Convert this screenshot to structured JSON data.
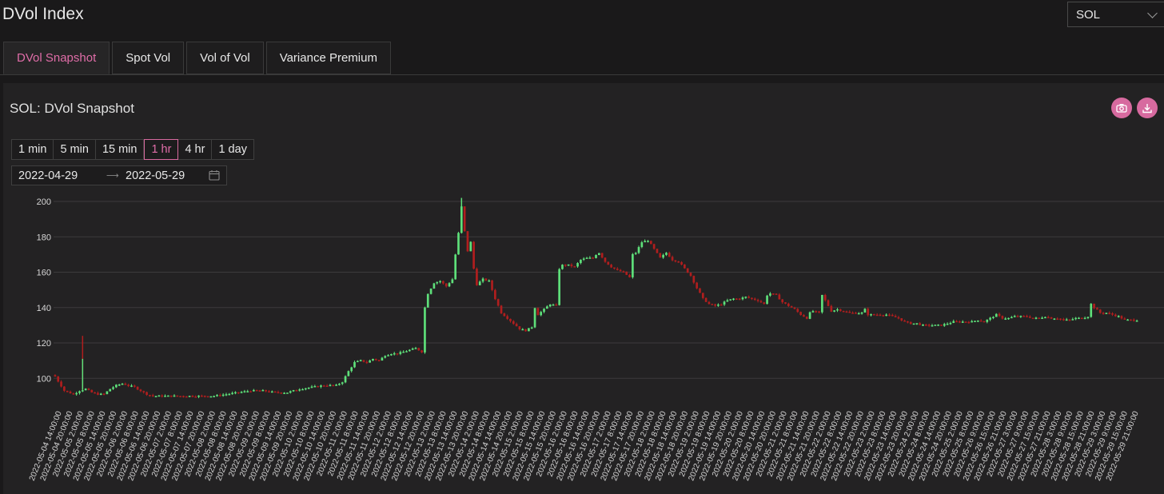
{
  "app": {
    "title": "DVol Index"
  },
  "asset_select": {
    "value": "SOL"
  },
  "tabs": [
    {
      "label": "DVol Snapshot",
      "active": true
    },
    {
      "label": "Spot Vol",
      "active": false
    },
    {
      "label": "Vol of Vol",
      "active": false
    },
    {
      "label": "Variance Premium",
      "active": false
    }
  ],
  "panel": {
    "title": "SOL: DVol Snapshot",
    "camera_icon": "camera-icon",
    "download_icon": "download-icon"
  },
  "ranges": [
    "1 min",
    "5 min",
    "15 min",
    "1 hr",
    "4 hr",
    "1 day"
  ],
  "selected_range": "1 hr",
  "date_range": {
    "start": "2022-04-29",
    "end": "2022-05-29",
    "icon": "calendar-icon"
  },
  "colors": {
    "accent": "#d76a9f",
    "up": "#5ee07a",
    "down": "#b01e1e",
    "background": "#1a191a"
  },
  "chart_data": {
    "type": "candlestick",
    "yticks": [
      100,
      120,
      140,
      160,
      180,
      200
    ],
    "ylim": [
      88,
      204
    ],
    "grid": true,
    "x_tick_labels": [
      "2022-05-04 14:00:00",
      "2022-05-04 20:00:00",
      "2022-05-05 2:00:00",
      "2022-05-05 8:00:00",
      "2022-05-05 14:00:00",
      "2022-05-05 20:00:00",
      "2022-05-06 2:00:00",
      "2022-05-06 8:00:00",
      "2022-05-06 14:00:00",
      "2022-05-06 20:00:00",
      "2022-05-07 2:00:00",
      "2022-05-07 8:00:00",
      "2022-05-07 14:00:00",
      "2022-05-07 20:00:00",
      "2022-05-08 2:00:00",
      "2022-05-08 8:00:00",
      "2022-05-08 14:00:00",
      "2022-05-08 20:00:00",
      "2022-05-09 2:00:00",
      "2022-05-09 8:00:00",
      "2022-05-09 14:00:00",
      "2022-05-09 20:00:00",
      "2022-05-10 2:00:00",
      "2022-05-10 8:00:00",
      "2022-05-10 14:00:00",
      "2022-05-10 20:00:00",
      "2022-05-11 2:00:00",
      "2022-05-11 8:00:00",
      "2022-05-11 14:00:00",
      "2022-05-11 20:00:00",
      "2022-05-12 2:00:00",
      "2022-05-12 8:00:00",
      "2022-05-12 14:00:00",
      "2022-05-12 20:00:00",
      "2022-05-13 2:00:00",
      "2022-05-13 8:00:00",
      "2022-05-13 14:00:00",
      "2022-05-13 20:00:00",
      "2022-05-14 2:00:00",
      "2022-05-14 8:00:00",
      "2022-05-14 14:00:00",
      "2022-05-14 20:00:00",
      "2022-05-15 2:00:00",
      "2022-05-15 8:00:00",
      "2022-05-15 14:00:00",
      "2022-05-15 20:00:00",
      "2022-05-16 2:00:00",
      "2022-05-16 8:00:00",
      "2022-05-16 14:00:00",
      "2022-05-16 20:00:00",
      "2022-05-17 2:00:00",
      "2022-05-17 8:00:00",
      "2022-05-17 14:00:00",
      "2022-05-17 20:00:00",
      "2022-05-18 2:00:00",
      "2022-05-18 8:00:00",
      "2022-05-18 14:00:00",
      "2022-05-18 20:00:00",
      "2022-05-19 2:00:00",
      "2022-05-19 8:00:00",
      "2022-05-19 14:00:00",
      "2022-05-19 20:00:00",
      "2022-05-20 2:00:00",
      "2022-05-20 8:00:00",
      "2022-05-20 14:00:00",
      "2022-05-20 20:00:00",
      "2022-05-21 2:00:00",
      "2022-05-21 8:00:00",
      "2022-05-21 14:00:00",
      "2022-05-21 20:00:00",
      "2022-05-22 2:00:00",
      "2022-05-22 8:00:00",
      "2022-05-22 14:00:00",
      "2022-05-22 20:00:00",
      "2022-05-23 2:00:00",
      "2022-05-23 8:00:00",
      "2022-05-23 14:00:00",
      "2022-05-23 20:00:00",
      "2022-05-24 2:00:00",
      "2022-05-24 8:00:00",
      "2022-05-24 14:00:00",
      "2022-05-24 20:00:00",
      "2022-05-25 2:00:00",
      "2022-05-25 8:00:00",
      "2022-05-26 9:00:00",
      "2022-05-26 15:00:00",
      "2022-05-26 21:00:00",
      "2022-05-27 3:00:00",
      "2022-05-27 9:00:00",
      "2022-05-27 15:00:00",
      "2022-05-27 21:00:00",
      "2022-05-28 3:00:00",
      "2022-05-28 9:00:00",
      "2022-05-28 15:00:00",
      "2022-05-28 21:00:00",
      "2022-05-29 3:00:00",
      "2022-05-29 9:00:00",
      "2022-05-29 15:00:00",
      "2022-05-29 21:00:00"
    ],
    "close_anchors": [
      [
        0,
        101
      ],
      [
        3,
        93
      ],
      [
        6,
        91
      ],
      [
        8,
        93
      ],
      [
        10,
        94
      ],
      [
        12,
        92
      ],
      [
        14,
        91
      ],
      [
        16,
        91
      ],
      [
        18,
        94
      ],
      [
        20,
        96
      ],
      [
        22,
        97
      ],
      [
        24,
        96
      ],
      [
        26,
        95
      ],
      [
        28,
        93
      ],
      [
        30,
        91
      ],
      [
        32,
        90
      ],
      [
        34,
        90
      ],
      [
        37,
        90
      ],
      [
        40,
        90
      ],
      [
        44,
        90
      ],
      [
        48,
        90
      ],
      [
        52,
        90
      ],
      [
        56,
        91
      ],
      [
        60,
        92
      ],
      [
        64,
        93
      ],
      [
        68,
        93
      ],
      [
        72,
        92
      ],
      [
        76,
        92
      ],
      [
        80,
        94
      ],
      [
        84,
        95
      ],
      [
        88,
        96
      ],
      [
        92,
        96
      ],
      [
        94,
        98
      ],
      [
        96,
        104
      ],
      [
        98,
        109
      ],
      [
        100,
        110
      ],
      [
        102,
        109
      ],
      [
        104,
        111
      ],
      [
        106,
        110
      ],
      [
        108,
        113
      ],
      [
        110,
        114
      ],
      [
        112,
        114
      ],
      [
        114,
        115
      ],
      [
        116,
        116
      ],
      [
        118,
        117
      ],
      [
        120,
        115
      ],
      [
        121,
        140
      ],
      [
        122,
        148
      ],
      [
        124,
        154
      ],
      [
        126,
        155
      ],
      [
        128,
        152
      ],
      [
        130,
        156
      ],
      [
        131,
        170
      ],
      [
        132,
        182
      ],
      [
        133,
        197
      ],
      [
        134,
        183
      ],
      [
        135,
        172
      ],
      [
        136,
        177
      ],
      [
        137,
        162
      ],
      [
        138,
        153
      ],
      [
        140,
        156
      ],
      [
        142,
        155
      ],
      [
        144,
        145
      ],
      [
        146,
        137
      ],
      [
        148,
        134
      ],
      [
        150,
        131
      ],
      [
        152,
        128
      ],
      [
        154,
        127
      ],
      [
        156,
        129
      ],
      [
        157,
        140
      ],
      [
        158,
        136
      ],
      [
        160,
        139
      ],
      [
        162,
        142
      ],
      [
        164,
        141
      ],
      [
        165,
        162
      ],
      [
        166,
        164
      ],
      [
        168,
        164
      ],
      [
        170,
        163
      ],
      [
        172,
        167
      ],
      [
        174,
        168
      ],
      [
        176,
        168
      ],
      [
        177,
        170
      ],
      [
        178,
        171
      ],
      [
        180,
        166
      ],
      [
        182,
        163
      ],
      [
        184,
        161
      ],
      [
        186,
        160
      ],
      [
        188,
        157
      ],
      [
        189,
        170
      ],
      [
        190,
        171
      ],
      [
        192,
        177
      ],
      [
        194,
        178
      ],
      [
        196,
        173
      ],
      [
        198,
        168
      ],
      [
        200,
        171
      ],
      [
        202,
        167
      ],
      [
        204,
        166
      ],
      [
        206,
        162
      ],
      [
        208,
        158
      ],
      [
        210,
        151
      ],
      [
        212,
        145
      ],
      [
        214,
        142
      ],
      [
        216,
        141
      ],
      [
        218,
        142
      ],
      [
        220,
        144
      ],
      [
        222,
        145
      ],
      [
        224,
        145
      ],
      [
        226,
        146
      ],
      [
        228,
        145
      ],
      [
        230,
        144
      ],
      [
        232,
        142
      ],
      [
        233,
        147
      ],
      [
        234,
        148
      ],
      [
        236,
        147
      ],
      [
        238,
        143
      ],
      [
        240,
        141
      ],
      [
        242,
        139
      ],
      [
        244,
        136
      ],
      [
        246,
        134
      ],
      [
        247,
        137
      ],
      [
        248,
        138
      ],
      [
        250,
        137
      ],
      [
        251,
        147
      ],
      [
        252,
        144
      ],
      [
        254,
        138
      ],
      [
        256,
        139
      ],
      [
        258,
        138
      ],
      [
        260,
        137
      ],
      [
        262,
        137
      ],
      [
        264,
        137
      ],
      [
        265,
        139
      ],
      [
        266,
        136
      ],
      [
        268,
        136
      ],
      [
        270,
        136
      ],
      [
        272,
        136
      ],
      [
        274,
        135
      ],
      [
        276,
        134
      ],
      [
        278,
        132
      ],
      [
        280,
        131
      ],
      [
        282,
        131
      ],
      [
        284,
        130
      ],
      [
        286,
        130
      ],
      [
        288,
        130
      ],
      [
        290,
        130
      ],
      [
        292,
        131
      ],
      [
        294,
        132
      ],
      [
        296,
        132
      ],
      [
        298,
        132
      ],
      [
        300,
        132
      ],
      [
        302,
        133
      ],
      [
        304,
        132
      ],
      [
        306,
        134
      ],
      [
        308,
        136
      ],
      [
        310,
        134
      ],
      [
        312,
        134
      ],
      [
        314,
        135
      ],
      [
        316,
        135
      ],
      [
        318,
        135
      ],
      [
        320,
        134
      ],
      [
        322,
        134
      ],
      [
        324,
        135
      ],
      [
        326,
        134
      ],
      [
        328,
        134
      ],
      [
        330,
        133
      ],
      [
        332,
        133
      ],
      [
        334,
        134
      ],
      [
        336,
        134
      ],
      [
        338,
        135
      ],
      [
        339,
        142
      ],
      [
        340,
        140
      ],
      [
        342,
        137
      ],
      [
        344,
        137
      ],
      [
        346,
        136
      ],
      [
        348,
        135
      ],
      [
        350,
        133
      ],
      [
        352,
        133
      ],
      [
        354,
        133
      ]
    ]
  }
}
